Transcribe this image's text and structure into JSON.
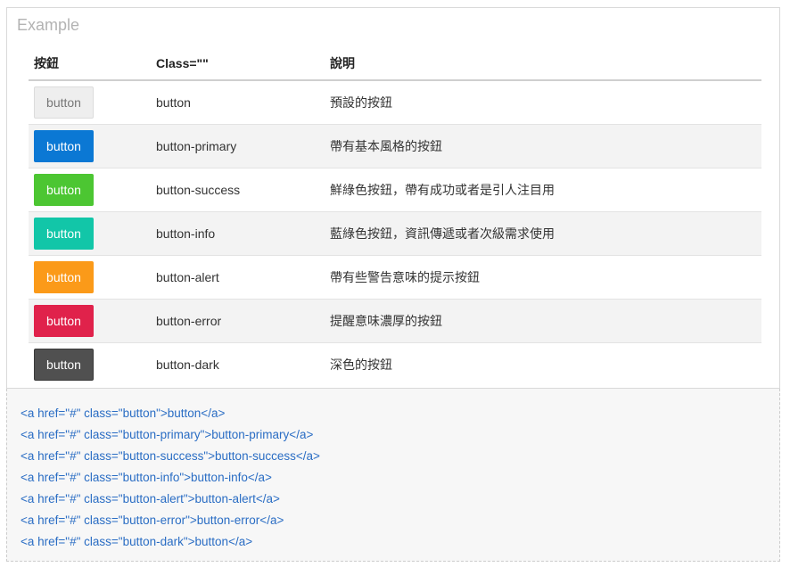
{
  "example": {
    "label": "Example"
  },
  "table": {
    "headers": [
      "按鈕",
      "Class=\"\"",
      "說明"
    ],
    "rows": [
      {
        "button_label": "button",
        "class_name": "button",
        "description": "預設的按鈕",
        "style": "default"
      },
      {
        "button_label": "button",
        "class_name": "button-primary",
        "description": "帶有基本風格的按鈕",
        "style": "primary"
      },
      {
        "button_label": "button",
        "class_name": "button-success",
        "description": "鮮綠色按鈕，帶有成功或者是引人注目用",
        "style": "success"
      },
      {
        "button_label": "button",
        "class_name": "button-info",
        "description": "藍綠色按鈕，資訊傳遞或者次級需求使用",
        "style": "info"
      },
      {
        "button_label": "button",
        "class_name": "button-alert",
        "description": "帶有些警告意味的提示按鈕",
        "style": "alert"
      },
      {
        "button_label": "button",
        "class_name": "button-error",
        "description": "提醒意味濃厚的按鈕",
        "style": "error"
      },
      {
        "button_label": "button",
        "class_name": "button-dark",
        "description": "深色的按鈕",
        "style": "dark"
      }
    ]
  },
  "code": {
    "lines": [
      "<a href=\"#\" class=\"button\">button</a>",
      "<a href=\"#\" class=\"button-primary\">button-primary</a>",
      "<a href=\"#\" class=\"button-success\">button-success</a>",
      "<a href=\"#\" class=\"button-info\">button-info</a>",
      "<a href=\"#\" class=\"button-alert\">button-alert</a>",
      "<a href=\"#\" class=\"button-error\">button-error</a>",
      "<a href=\"#\" class=\"button-dark\">button</a>"
    ]
  },
  "colors": {
    "default": "#eeeeee",
    "primary": "#0b78d4",
    "success": "#4cc632",
    "info": "#12c6a8",
    "alert": "#fb9a19",
    "error": "#e0224b",
    "dark": "#505050",
    "code_text": "#2a6dc4"
  }
}
